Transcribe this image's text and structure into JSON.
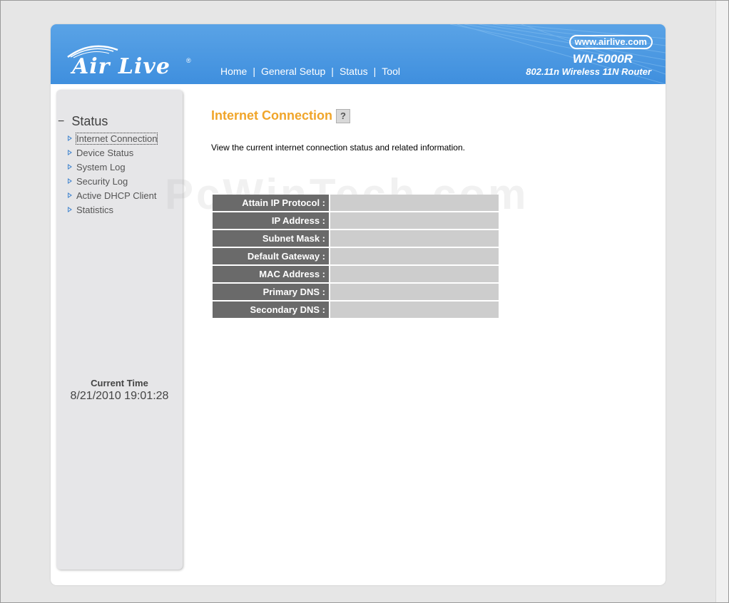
{
  "header": {
    "logo_text": "Air Live",
    "logo_reg": "®",
    "brand_url": "www.airlive.com",
    "model": "WN-5000R",
    "model_desc": "802.11n Wireless 11N Router",
    "nav": [
      {
        "label": "Home"
      },
      {
        "label": "General Setup"
      },
      {
        "label": "Status"
      },
      {
        "label": "Tool"
      }
    ],
    "nav_separator": "|"
  },
  "sidebar": {
    "section_toggle": "−",
    "section_title": "Status",
    "items": [
      {
        "label": "Internet Connection"
      },
      {
        "label": "Device Status"
      },
      {
        "label": "System Log"
      },
      {
        "label": "Security Log"
      },
      {
        "label": "Active DHCP Client"
      },
      {
        "label": "Statistics"
      }
    ],
    "current_time_label": "Current Time",
    "current_time_value": "8/21/2010 19:01:28"
  },
  "main": {
    "title": "Internet Connection",
    "help_icon_glyph": "?",
    "description": "View the current internet connection status and related information.",
    "watermark": "PcWinTech.com",
    "rows": [
      {
        "label": "Attain IP Protocol :",
        "value": ""
      },
      {
        "label": "IP Address :",
        "value": ""
      },
      {
        "label": "Subnet Mask :",
        "value": ""
      },
      {
        "label": "Default Gateway :",
        "value": ""
      },
      {
        "label": "MAC Address :",
        "value": ""
      },
      {
        "label": "Primary DNS :",
        "value": ""
      },
      {
        "label": "Secondary DNS :",
        "value": ""
      }
    ]
  },
  "colors": {
    "header_blue": "#4a98e2",
    "title_orange": "#f0a52a",
    "label_gray": "#6a6a6a",
    "value_gray": "#cdcdcd"
  }
}
